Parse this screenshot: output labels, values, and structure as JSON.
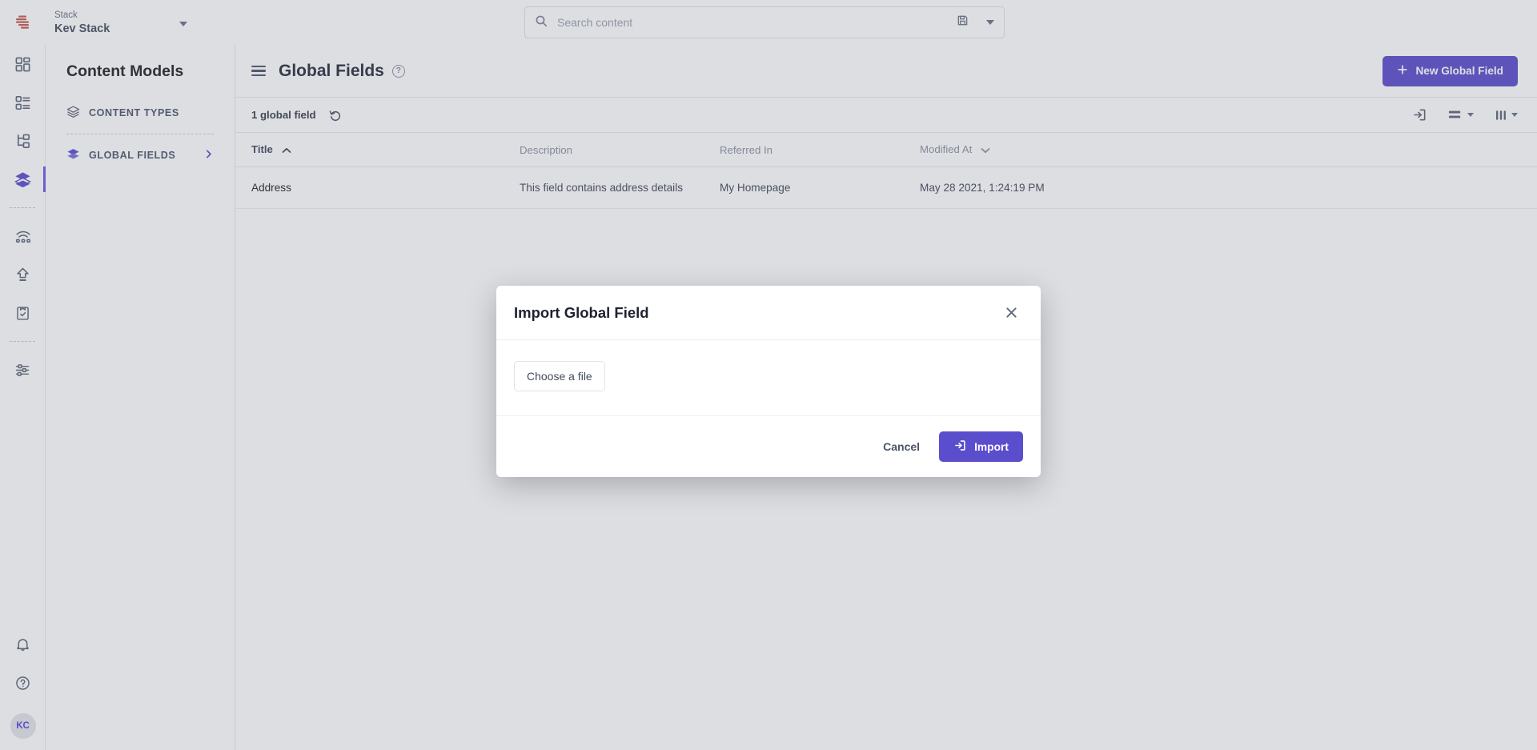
{
  "brand": {
    "logo_icon": "contentstack-logo-icon",
    "accent_color": "#5b4ecd",
    "logo_color": "#c75a52"
  },
  "topbar": {
    "stack_label": "Stack",
    "stack_name": "Kev Stack",
    "stack_caret_icon": "chevron-down-icon",
    "search": {
      "icon": "search-icon",
      "placeholder": "Search content",
      "saved_view_icon": "save-icon",
      "caret_icon": "chevron-down-icon"
    }
  },
  "rail": {
    "items": [
      {
        "icon": "dashboard-grid-icon",
        "active": false
      },
      {
        "icon": "entries-list-icon",
        "active": false
      },
      {
        "icon": "sitemap-hierarchy-icon",
        "active": false
      },
      {
        "icon": "content-models-stack-icon",
        "active": true
      },
      {
        "icon": "live-preview-wifi-icon",
        "active": false
      },
      {
        "icon": "publish-upload-icon",
        "active": false
      },
      {
        "icon": "tasks-clipboard-check-icon",
        "active": false
      },
      {
        "icon": "settings-sliders-icon",
        "active": false
      }
    ],
    "bottom": [
      {
        "icon": "bell-notification-icon"
      },
      {
        "icon": "help-question-circle-icon"
      }
    ],
    "avatar_initials": "KC"
  },
  "leftpanel": {
    "title": "Content Models",
    "items": [
      {
        "label": "CONTENT TYPES",
        "icon": "layers-stack-icon",
        "active": false,
        "chevron": false
      },
      {
        "label": "GLOBAL FIELDS",
        "icon": "layers-stack-icon",
        "active": true,
        "chevron": true
      }
    ],
    "chevron_icon": "chevron-right-icon"
  },
  "main": {
    "menu_icon": "hamburger-menu-icon",
    "page_title": "Global Fields",
    "help_icon": "help-question-circle-icon",
    "new_button": {
      "label": "New Global Field",
      "icon": "plus-icon"
    },
    "subbar": {
      "count_text": "1 global field",
      "refresh_icon": "refresh-undo-icon",
      "tools": [
        {
          "icon": "import-arrow-into-box-icon",
          "caret": false,
          "name": "import-button"
        },
        {
          "icon": "row-density-icon",
          "caret": true,
          "name": "row-density-button"
        },
        {
          "icon": "columns-icon",
          "caret": true,
          "name": "column-selector-button"
        }
      ]
    },
    "table": {
      "columns": [
        {
          "label": "Title",
          "sorted": true,
          "sort_dir": "asc",
          "sort_icon": "chevron-up-icon"
        },
        {
          "label": "Description",
          "sorted": false,
          "sort_dir": "",
          "sort_icon": ""
        },
        {
          "label": "Referred In",
          "sorted": false,
          "sort_dir": "",
          "sort_icon": ""
        },
        {
          "label": "Modified At",
          "sorted": false,
          "sort_dir": "desc",
          "sort_icon": "chevron-down-icon"
        }
      ],
      "rows": [
        {
          "title": "Address",
          "description": "This field contains address details",
          "referred_in": "My Homepage",
          "modified_at": "May 28 2021, 1:24:19 PM"
        }
      ]
    }
  },
  "modal": {
    "title": "Import Global Field",
    "close_icon": "close-x-icon",
    "choose_file_label": "Choose a file",
    "cancel_label": "Cancel",
    "import_label": "Import",
    "import_icon": "import-arrow-into-box-icon"
  }
}
